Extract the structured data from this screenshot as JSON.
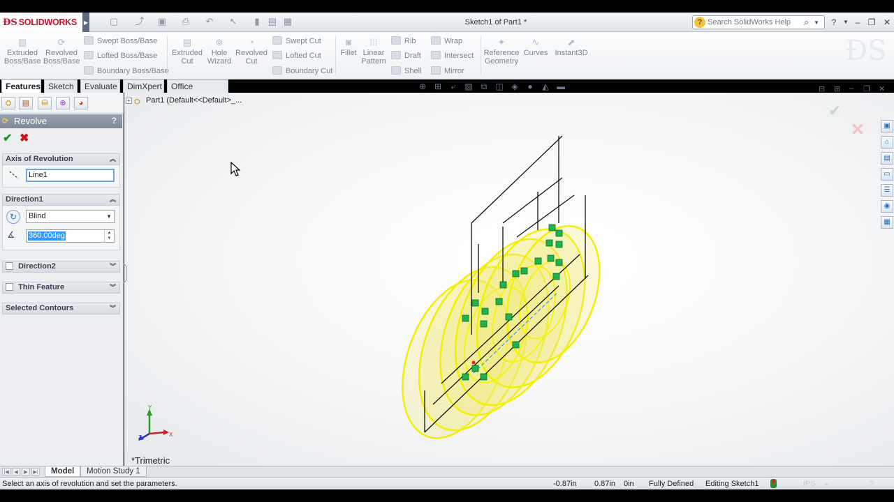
{
  "app": {
    "logo_text": "SOLIDWORKS",
    "document_title": "Sketch1 of Part1 *",
    "search_placeholder": "Search SolidWorks Help"
  },
  "ribbon": {
    "extruded_boss": "Extruded Boss/Base",
    "revolved_boss": "Revolved Boss/Base",
    "swept_boss": "Swept Boss/Base",
    "lofted_boss": "Lofted Boss/Base",
    "boundary_boss": "Boundary Boss/Base",
    "extruded_cut": "Extruded Cut",
    "hole_wizard": "Hole Wizard",
    "revolved_cut": "Revolved Cut",
    "swept_cut": "Swept Cut",
    "lofted_cut": "Lofted Cut",
    "boundary_cut": "Boundary Cut",
    "fillet": "Fillet",
    "linear_pattern": "Linear Pattern",
    "rib": "Rib",
    "draft": "Draft",
    "shell": "Shell",
    "wrap": "Wrap",
    "intersect": "Intersect",
    "mirror": "Mirror",
    "reference_geometry": "Reference Geometry",
    "curves": "Curves",
    "instant3d": "Instant3D"
  },
  "command_tabs": [
    "Features",
    "Sketch",
    "Evaluate",
    "DimXpert",
    "Office Products"
  ],
  "property_manager": {
    "title": "Revolve",
    "help": "?",
    "axis_group": "Axis of Revolution",
    "axis_value": "Line1",
    "direction1_group": "Direction1",
    "direction1_type": "Blind",
    "angle_value": "360.00deg",
    "direction2_group": "Direction2",
    "thin_feature_group": "Thin Feature",
    "selected_contours_group": "Selected Contours"
  },
  "feature_tree": {
    "root": "Part1  (Default<<Default>_..."
  },
  "viewport": {
    "view_name": "*Trimetric"
  },
  "bottom_tabs": [
    "Model",
    "Motion Study 1"
  ],
  "status": {
    "message": "Select an axis of revolution and set the parameters.",
    "x_coord": "-0.87in",
    "y_coord": "0.87in",
    "z_coord": "0in",
    "sketch_state": "Fully Defined",
    "editing": "Editing Sketch1"
  },
  "colors": {
    "brand_red": "#c8102e",
    "preview_yellow": "#f2f000",
    "relation_green": "#1fb24a",
    "ok_green": "#1d9a1d",
    "cancel_red": "#d0121b"
  }
}
